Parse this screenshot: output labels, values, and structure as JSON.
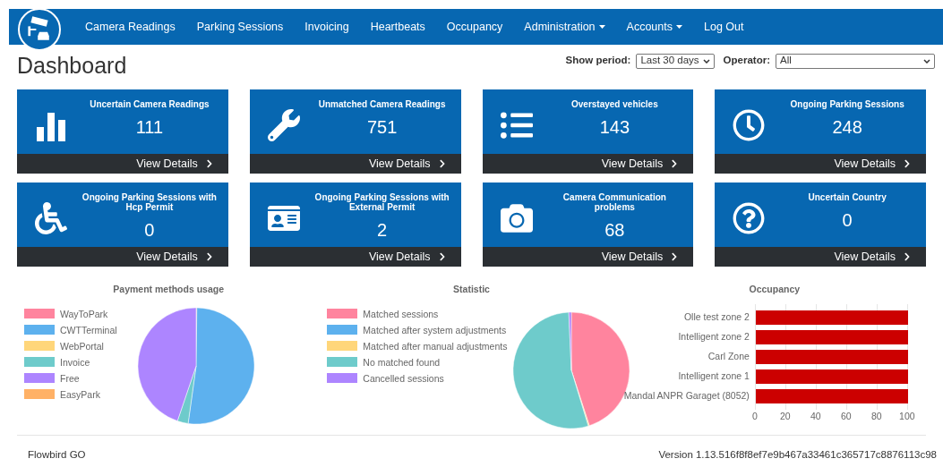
{
  "nav": {
    "items": [
      {
        "label": "Camera Readings",
        "dropdown": false
      },
      {
        "label": "Parking Sessions",
        "dropdown": false
      },
      {
        "label": "Invoicing",
        "dropdown": false
      },
      {
        "label": "Heartbeats",
        "dropdown": false
      },
      {
        "label": "Occupancy",
        "dropdown": false
      },
      {
        "label": "Administration",
        "dropdown": true
      },
      {
        "label": "Accounts",
        "dropdown": true
      },
      {
        "label": "Log Out",
        "dropdown": false
      }
    ]
  },
  "page_title": "Dashboard",
  "filters": {
    "period_label": "Show period:",
    "period_value": "Last 30 days",
    "operator_label": "Operator:",
    "operator_value": "All"
  },
  "tiles": [
    {
      "title": "Uncertain Camera Readings",
      "count": "111",
      "link": "View Details"
    },
    {
      "title": "Unmatched Camera Readings",
      "count": "751",
      "link": "View Details"
    },
    {
      "title": "Overstayed vehicles",
      "count": "143",
      "link": "View Details"
    },
    {
      "title": "Ongoing Parking Sessions",
      "count": "248",
      "link": "View Details"
    },
    {
      "title": "Ongoing Parking Sessions with Hcp Permit",
      "count": "0",
      "link": "View Details"
    },
    {
      "title": "Ongoing Parking Sessions with External Permit",
      "count": "2",
      "link": "View Details"
    },
    {
      "title": "Camera Communication problems",
      "count": "68",
      "link": "View Details"
    },
    {
      "title": "Uncertain Country",
      "count": "0",
      "link": "View Details"
    }
  ],
  "payment_chart": {
    "title": "Payment methods usage",
    "legend": [
      {
        "label": "WayToPark",
        "color": "#ff849e"
      },
      {
        "label": "CWTTerminal",
        "color": "#5db1ee"
      },
      {
        "label": "WebPortal",
        "color": "#ffd67a"
      },
      {
        "label": "Invoice",
        "color": "#6ecbcb"
      },
      {
        "label": "Free",
        "color": "#ad85ff"
      },
      {
        "label": "EasyPark",
        "color": "#ffb166"
      }
    ]
  },
  "statistic_chart": {
    "title": "Statistic",
    "legend": [
      {
        "label": "Matched sessions",
        "color": "#ff849e"
      },
      {
        "label": "Matched after system adjustments",
        "color": "#5db1ee"
      },
      {
        "label": "Matched after manual adjustments",
        "color": "#ffd67a"
      },
      {
        "label": "No matched found",
        "color": "#6ecbcb"
      },
      {
        "label": "Cancelled sessions",
        "color": "#ad85ff"
      }
    ]
  },
  "occupancy": {
    "chart_data": {
      "type": "bar",
      "orientation": "horizontal",
      "title": "Occupancy",
      "categories": [
        "Olle test zone 2",
        "Intelligent zone 2",
        "Carl Zone",
        "Intelligent zone 1",
        "Mandal ANPR Garaget (8052)"
      ],
      "series": [
        {
          "color": "#cc0000",
          "values": [
            100,
            100,
            100,
            100,
            100
          ]
        }
      ],
      "xlim": [
        0,
        100
      ],
      "xticks": [
        0,
        20,
        40,
        60,
        80,
        100
      ],
      "grid": true
    }
  },
  "footer": {
    "brand": "Flowbird GO",
    "version": "Version 1.13.516f8f8ef7e9b467a33461c365717c8876113c98"
  }
}
